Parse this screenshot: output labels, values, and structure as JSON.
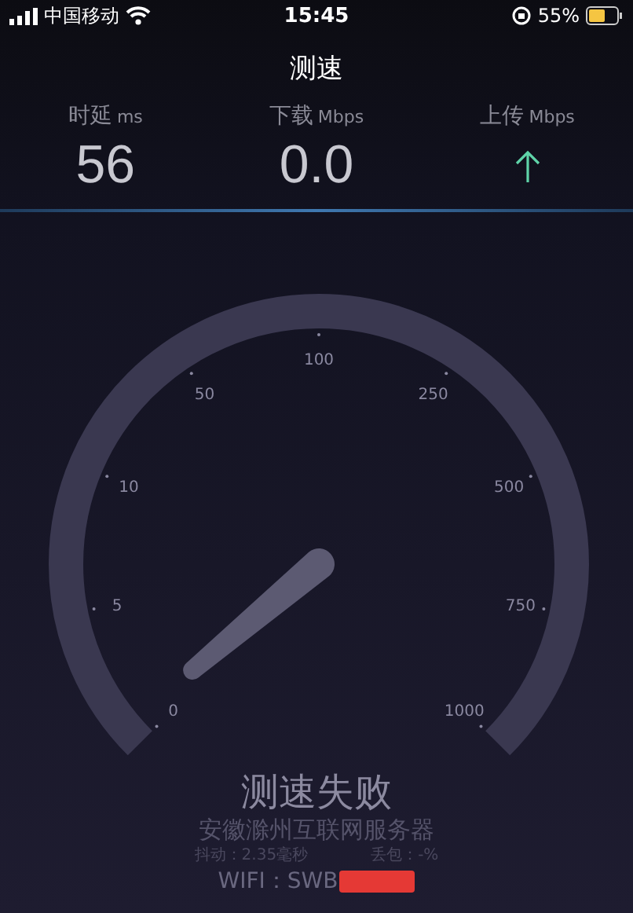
{
  "status_bar": {
    "carrier": "中国移动",
    "time": "15:45",
    "battery": "55%"
  },
  "title": "测速",
  "stats": [
    {
      "label": "时延",
      "unit": "ms",
      "value": "56"
    },
    {
      "label": "下载",
      "unit": "Mbps",
      "value": "0.0"
    },
    {
      "label": "上传",
      "unit": "Mbps",
      "kind": "arrow"
    }
  ],
  "gauge": {
    "ticks": [
      "0",
      "5",
      "10",
      "50",
      "100",
      "250",
      "500",
      "750",
      "1000"
    ]
  },
  "result": {
    "status": "测速失败",
    "server": "安徽滁州互联网服务器",
    "jitter": "抖动：2.35毫秒",
    "loss": "丢包：-%",
    "network": "WIFI：SWB"
  }
}
